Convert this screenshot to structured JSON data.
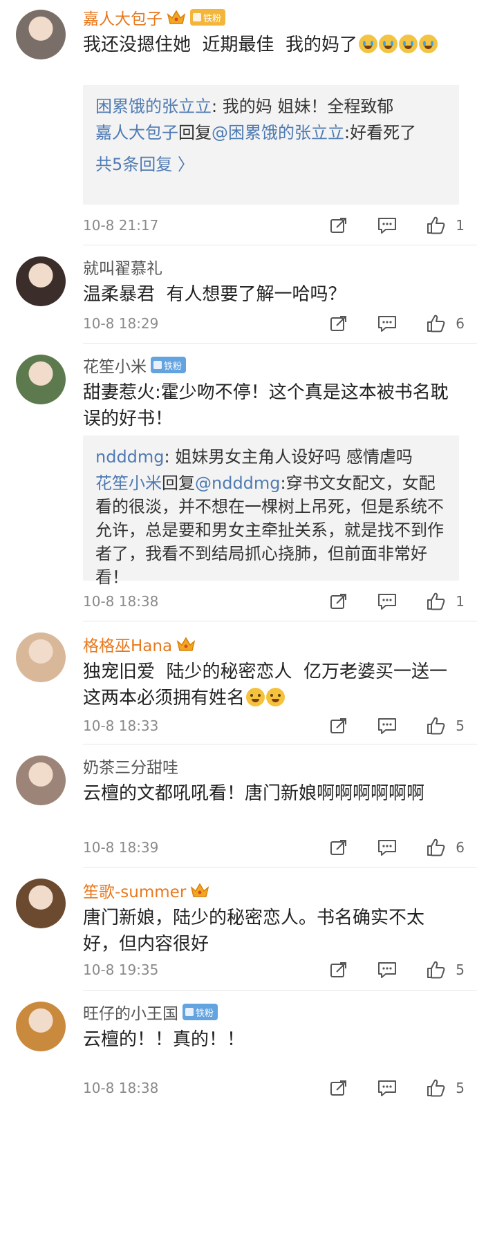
{
  "comments": [
    {
      "user": "嘉人大包子",
      "name_style": "gold",
      "crown": true,
      "badge": "铁粉",
      "badge_style": "gold",
      "avatar_color": "#7a6f68",
      "text": "我还没摁住她  近期最佳  我的妈了",
      "emojis": [
        "cry-emoji",
        "cry-emoji",
        "cry-emoji",
        "cry-emoji"
      ],
      "replies": [
        {
          "user": "困累饿的张立立",
          "text": ": 我的妈  姐妹！全程致郁"
        },
        {
          "user": "嘉人大包子",
          "mid": "回复",
          "target": "@困累饿的张立立",
          "text": ":好看死了"
        }
      ],
      "more": "共5条回复 〉",
      "time": "10-8 21:17",
      "likes": "1"
    },
    {
      "user": "就叫翟慕礼",
      "name_style": "gray",
      "crown": false,
      "badge": "",
      "avatar_color": "#3b2e2a",
      "text": "温柔暴君  有人想要了解一哈吗？",
      "time": "10-8 18:29",
      "likes": "6"
    },
    {
      "user": "花笙小米",
      "name_style": "gray",
      "crown": false,
      "badge": "铁粉",
      "badge_style": "blue",
      "avatar_color": "#5c7a4e",
      "text": "甜妻惹火:霍少吻不停！这个真是这本被书名耽误的好书！",
      "replies": [
        {
          "user": "ndddmg",
          "text": ": 姐妹男女主角人设好吗  感情虐吗"
        },
        {
          "user": "花笙小米",
          "mid": "回复",
          "target": "@ndddmg",
          "text": ":穿书文女配文，女配看的很淡，并不想在一棵树上吊死，但是系统不允许，总是要和男女主牵扯关系，就是找不到作者了，我看不到结局抓心挠肺，但前面非常好看！"
        }
      ],
      "time": "10-8 18:38",
      "likes": "1"
    },
    {
      "user": "格格巫Hana",
      "name_style": "gold",
      "crown": true,
      "badge": "",
      "avatar_color": "#d9b89a",
      "text": "独宠旧爱  陆少的秘密恋人  亿万老婆买一送一  这两本必须拥有姓名",
      "emojis": [
        "laugh-cry-emoji",
        "laugh-cry-emoji"
      ],
      "time": "10-8 18:33",
      "likes": "5"
    },
    {
      "user": "奶茶三分甜哇",
      "name_style": "gray",
      "crown": false,
      "badge": "",
      "avatar_color": "#9c8478",
      "text": "云檀的文都吼吼看！唐门新娘啊啊啊啊啊啊",
      "time": "10-8 18:39",
      "likes": "6"
    },
    {
      "user": "笙歌-summer",
      "name_style": "gold",
      "crown": true,
      "badge": "",
      "avatar_color": "#6b4a2f",
      "text": "唐门新娘，陆少的秘密恋人。书名确实不太好，但内容很好",
      "time": "10-8 19:35",
      "likes": "5"
    },
    {
      "user": "旺仔的小王国",
      "name_style": "gray",
      "crown": false,
      "badge": "铁粉",
      "badge_style": "blue",
      "avatar_color": "#c98a3d",
      "text": "云檀的！！真的！！",
      "time": "10-8 18:38",
      "likes": "5"
    }
  ],
  "icons": {
    "repost": "repost-icon",
    "comment": "comment-icon",
    "like": "like-icon"
  },
  "colors": {
    "gold_name": "#e8791e",
    "link_blue": "#4f7bb3",
    "badge_blue": "#63a3e0",
    "badge_gold": "#f4b63a",
    "reply_bg": "#f3f3f3"
  }
}
